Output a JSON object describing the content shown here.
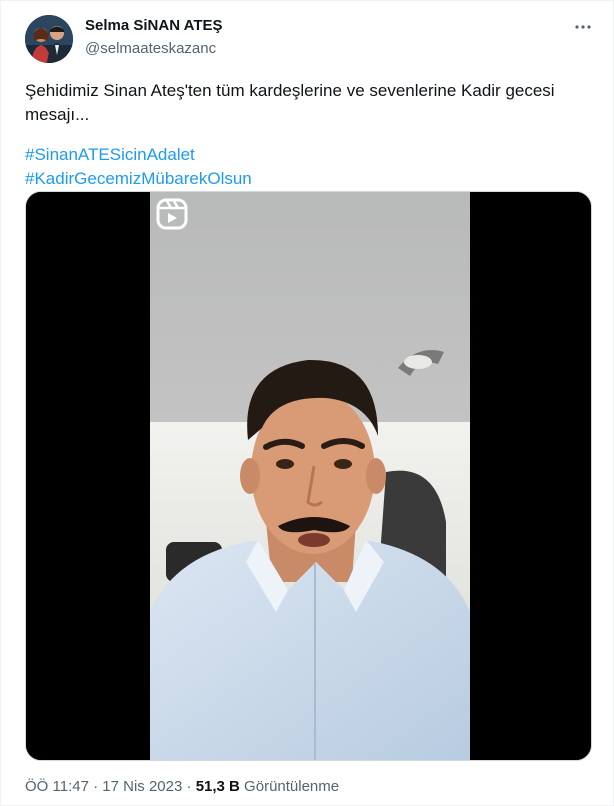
{
  "author": {
    "name": "Selma SiNAN ATEŞ",
    "handle": "@selmaateskazanc"
  },
  "tweet": {
    "text_line1": "Şehidimiz Sinan Ateş'ten tüm kardeşlerine ve sevenlerine Kadir gecesi",
    "text_line2": "mesajı...",
    "hashtags": [
      "#SinanATESicinAdalet",
      "#KadirGecemizMübarekOlsun"
    ]
  },
  "media": {
    "type": "video",
    "badge_icon": "reels-icon"
  },
  "meta": {
    "time": "ÖÖ 11:47",
    "sep1": " · ",
    "date": "17 Nis 2023",
    "sep2": " · ",
    "views_count": "51,3 B",
    "views_label": " Görüntülenme"
  },
  "colors": {
    "accent": "#1d9bf0",
    "secondary_text": "#536471"
  }
}
